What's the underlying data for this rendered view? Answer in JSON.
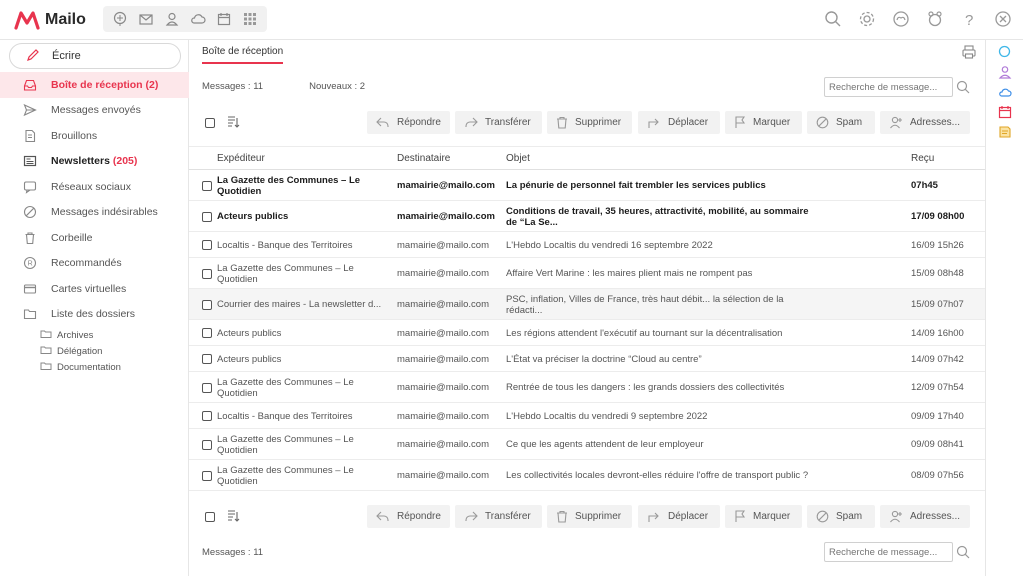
{
  "app": {
    "name": "Mailo"
  },
  "top_apps": [
    "brain-icon",
    "mail-icon",
    "contacts-icon",
    "cloud-icon",
    "calendar-icon",
    "grid-apps-icon"
  ],
  "top_right": [
    "search-icon",
    "settings-icon",
    "gamepad-icon",
    "family-icon",
    "help-icon",
    "close-icon"
  ],
  "compose": {
    "label": "Écrire"
  },
  "nav": {
    "inbox": "Boîte de réception (2)",
    "sent": "Messages envoyés",
    "drafts": "Brouillons",
    "newsletters": "Newsletters",
    "newsletters_count": "(205)",
    "social": "Réseaux sociaux",
    "spam": "Messages indésirables",
    "trash": "Corbeille",
    "registered": "Recommandés",
    "virtual_cards": "Cartes virtuelles",
    "folders": "Liste des dossiers",
    "subfolders": [
      "Archives",
      "Délégation",
      "Documentation"
    ]
  },
  "main": {
    "tab": "Boîte de réception",
    "messages_count": "Messages : 11",
    "new_count": "Nouveaux : 2",
    "search_placeholder": "Recherche de message...",
    "actions": {
      "reply": "Répondre",
      "forward": "Transférer",
      "delete": "Supprimer",
      "move": "Déplacer",
      "mark": "Marquer",
      "spam": "Spam",
      "addresses": "Adresses..."
    },
    "columns": {
      "from": "Expéditeur",
      "to": "Destinataire",
      "subject": "Objet",
      "received": "Reçu"
    }
  },
  "messages": [
    {
      "from1": "La Gazette des Communes – Le",
      "from2": "Quotidien",
      "to": "mamairie@mailo.com",
      "subj1": "La pénurie de personnel fait trembler les services publics",
      "subj2": "",
      "date": "07h45",
      "unread": true
    },
    {
      "from1": "Acteurs publics",
      "from2": "",
      "to": "mamairie@mailo.com",
      "subj1": "Conditions de travail, 35 heures, attractivité, mobilité, au sommaire",
      "subj2": "de “La Se...",
      "date": "17/09 08h00",
      "unread": true
    },
    {
      "from1": "Localtis - Banque des Territoires",
      "from2": "",
      "to": "mamairie@mailo.com",
      "subj1": "L'Hebdo Localtis du vendredi 16 septembre 2022",
      "subj2": "",
      "date": "16/09 15h26",
      "unread": false
    },
    {
      "from1": "La Gazette des Communes – Le",
      "from2": "Quotidien",
      "to": "mamairie@mailo.com",
      "subj1": "Affaire Vert Marine : les maires plient mais ne rompent pas",
      "subj2": "",
      "date": "15/09 08h48",
      "unread": false
    },
    {
      "from1": "Courrier des maires - La newsletter d...",
      "from2": "",
      "to": "mamairie@mailo.com",
      "subj1": "PSC, inflation, Villes de France, très haut débit... la sélection de la",
      "subj2": "rédacti...",
      "date": "15/09 07h07",
      "unread": false
    },
    {
      "from1": "Acteurs publics",
      "from2": "",
      "to": "mamairie@mailo.com",
      "subj1": "Les régions attendent l'exécutif au tournant sur la décentralisation",
      "subj2": "",
      "date": "14/09 16h00",
      "unread": false
    },
    {
      "from1": "Acteurs publics",
      "from2": "",
      "to": "mamairie@mailo.com",
      "subj1": "L'État va préciser la doctrine “Cloud au centre”",
      "subj2": "",
      "date": "14/09 07h42",
      "unread": false
    },
    {
      "from1": "La Gazette des Communes – Le",
      "from2": "Quotidien",
      "to": "mamairie@mailo.com",
      "subj1": "Rentrée de tous les dangers : les grands dossiers des collectivités",
      "subj2": "",
      "date": "12/09 07h54",
      "unread": false
    },
    {
      "from1": "Localtis - Banque des Territoires",
      "from2": "",
      "to": "mamairie@mailo.com",
      "subj1": "L'Hebdo Localtis du vendredi 9 septembre 2022",
      "subj2": "",
      "date": "09/09 17h40",
      "unread": false
    },
    {
      "from1": "La Gazette des Communes – Le",
      "from2": "Quotidien",
      "to": "mamairie@mailo.com",
      "subj1": "Ce que les agents attendent de leur employeur",
      "subj2": "",
      "date": "09/09 08h41",
      "unread": false
    },
    {
      "from1": "La Gazette des Communes – Le",
      "from2": "Quotidien",
      "to": "mamairie@mailo.com",
      "subj1": "Les collectivités locales devront-elles réduire l'offre de transport public ?",
      "subj2": "",
      "date": "08/09 07h56",
      "unread": false
    }
  ],
  "footer": {
    "messages_count": "Messages : 11"
  },
  "right_rail": [
    "search-icon",
    "contacts-icon",
    "cloud-icon",
    "calendar-icon",
    "notes-icon"
  ],
  "colors": {
    "accent": "#e8344e",
    "active_bg": "#fde7ea",
    "button_bg": "#f2f2f2"
  }
}
